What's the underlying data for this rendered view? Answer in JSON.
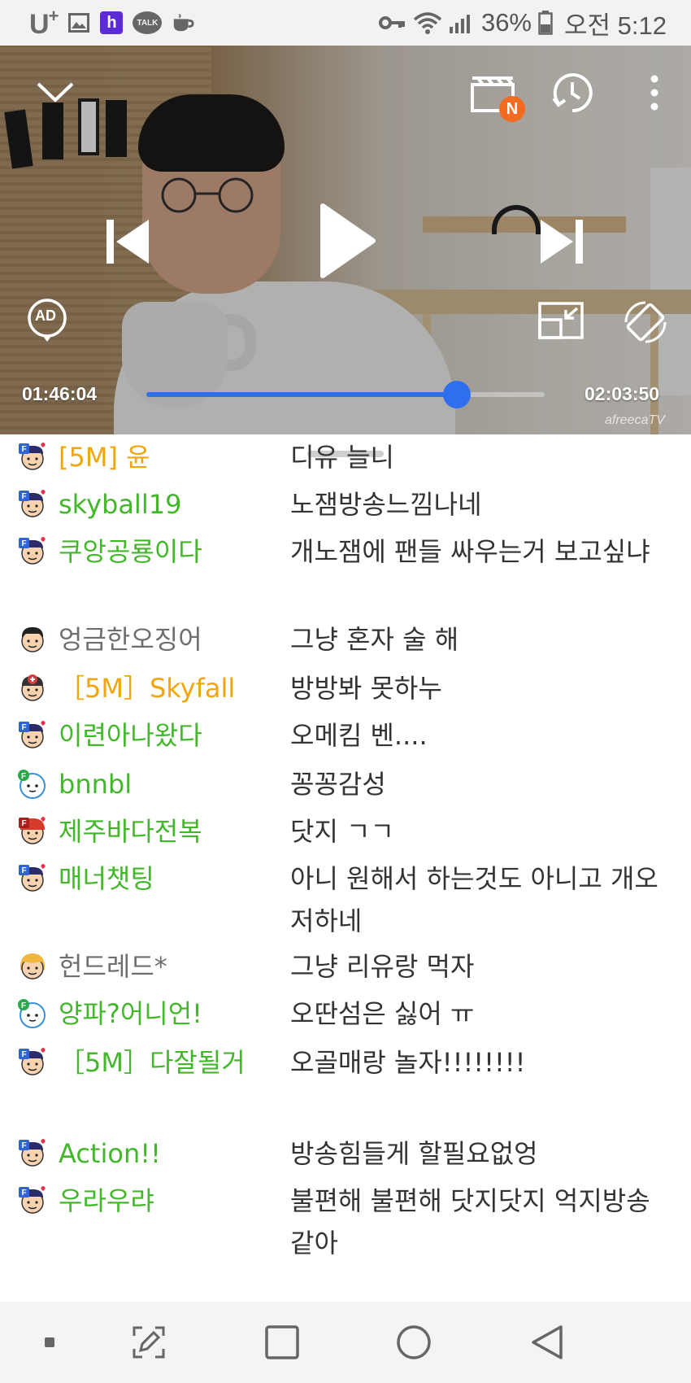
{
  "status_bar": {
    "carrier": "U",
    "carrier_plus": "+",
    "hbadge": "h",
    "talk": "TALK",
    "battery": "36%",
    "clock": "오전 5:12",
    "icons": [
      "image-icon",
      "hbadge-icon",
      "talk-icon",
      "coffee-icon",
      "key-icon",
      "wifi-icon",
      "signal-icon",
      "battery-icon"
    ]
  },
  "player": {
    "current_time": "01:46:04",
    "total_time": "02:03:50",
    "progress": 0.78,
    "accent_color": "#2f6fef",
    "new_badge": "N",
    "ad_label": "AD",
    "watermark": "afreecaTV"
  },
  "chat": [
    {
      "nick": "[5M] 윤",
      "msg": "디유 늘니",
      "nick_color": "orange",
      "avatar": "fan-heart"
    },
    {
      "nick": "skyball19",
      "msg": "노잼방송느낌나네",
      "nick_color": "green",
      "avatar": "fan-heart"
    },
    {
      "nick": "쿠앙공룡이다",
      "msg": "개노잼에 팬들 싸우는거 보고싶냐",
      "nick_color": "green",
      "avatar": "fan-heart"
    },
    {
      "nick": "엉금한오징어",
      "msg": "그냥 혼자 술 해",
      "nick_color": "gray",
      "avatar": "plain"
    },
    {
      "nick": "［5M］Skyfall",
      "msg": "방방봐 못하누",
      "nick_color": "orange",
      "avatar": "manager"
    },
    {
      "nick": "이련아나왔다",
      "msg": "오메킴 벤....",
      "nick_color": "green",
      "avatar": "fan-heart"
    },
    {
      "nick": "bnnbl",
      "msg": "꽁꽁감성",
      "nick_color": "green",
      "avatar": "fan-green"
    },
    {
      "nick": "제주바다전복",
      "msg": "닷지 ㄱㄱ",
      "nick_color": "green",
      "avatar": "fan-red"
    },
    {
      "nick": "매너챗팅",
      "msg": "아니 원해서 하는것도 아니고 개오저하네",
      "nick_color": "green",
      "avatar": "fan-heart"
    },
    {
      "nick": "헌드레드*",
      "msg": "그냥 리유랑 먹자",
      "nick_color": "gray",
      "avatar": "blond"
    },
    {
      "nick": "양파?어니언!",
      "msg": "오딴섬은 싫어 ㅠ",
      "nick_color": "green",
      "avatar": "fan-green"
    },
    {
      "nick": "［5M］다잘될거",
      "msg": "오골매랑 놀자!!!!!!!!",
      "nick_color": "green",
      "avatar": "fan-heart"
    },
    {
      "nick": "Action!!",
      "msg": "방송힘들게 할필요없엉",
      "nick_color": "green",
      "avatar": "fan-heart"
    },
    {
      "nick": "우라우랴",
      "msg": "불편해 불편해 닷지닷지 억지방송같아",
      "nick_color": "green",
      "avatar": "fan-heart"
    }
  ],
  "colors": {
    "nick_green": "#42b72a",
    "nick_orange": "#f2a50c",
    "nick_gray": "#6e6e6e"
  }
}
